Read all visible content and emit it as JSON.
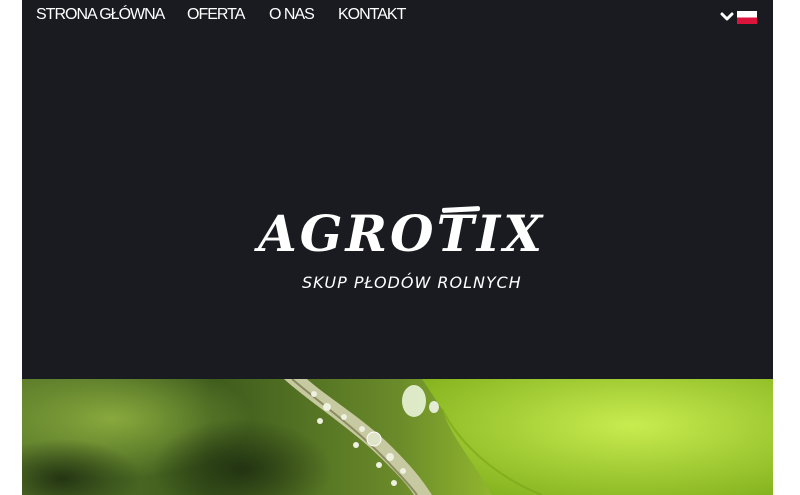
{
  "nav": {
    "items": [
      {
        "label": "STRONA GŁÓWNA"
      },
      {
        "label": "OFERTA"
      },
      {
        "label": "O NAS"
      },
      {
        "label": "KONTAKT"
      }
    ]
  },
  "language": {
    "icon": "chevron-down-icon",
    "flag": "poland-flag-icon",
    "flag_colors": [
      "#ffffff",
      "#dc143c"
    ]
  },
  "logo": {
    "main": "AGROTIX",
    "tagline": "SKUP PŁODÓW ROLNYCH"
  },
  "colors": {
    "page_background": "#191b21",
    "text": "#ffffff"
  },
  "hero": {
    "image": "plant-stem-with-water-droplets-photo"
  }
}
